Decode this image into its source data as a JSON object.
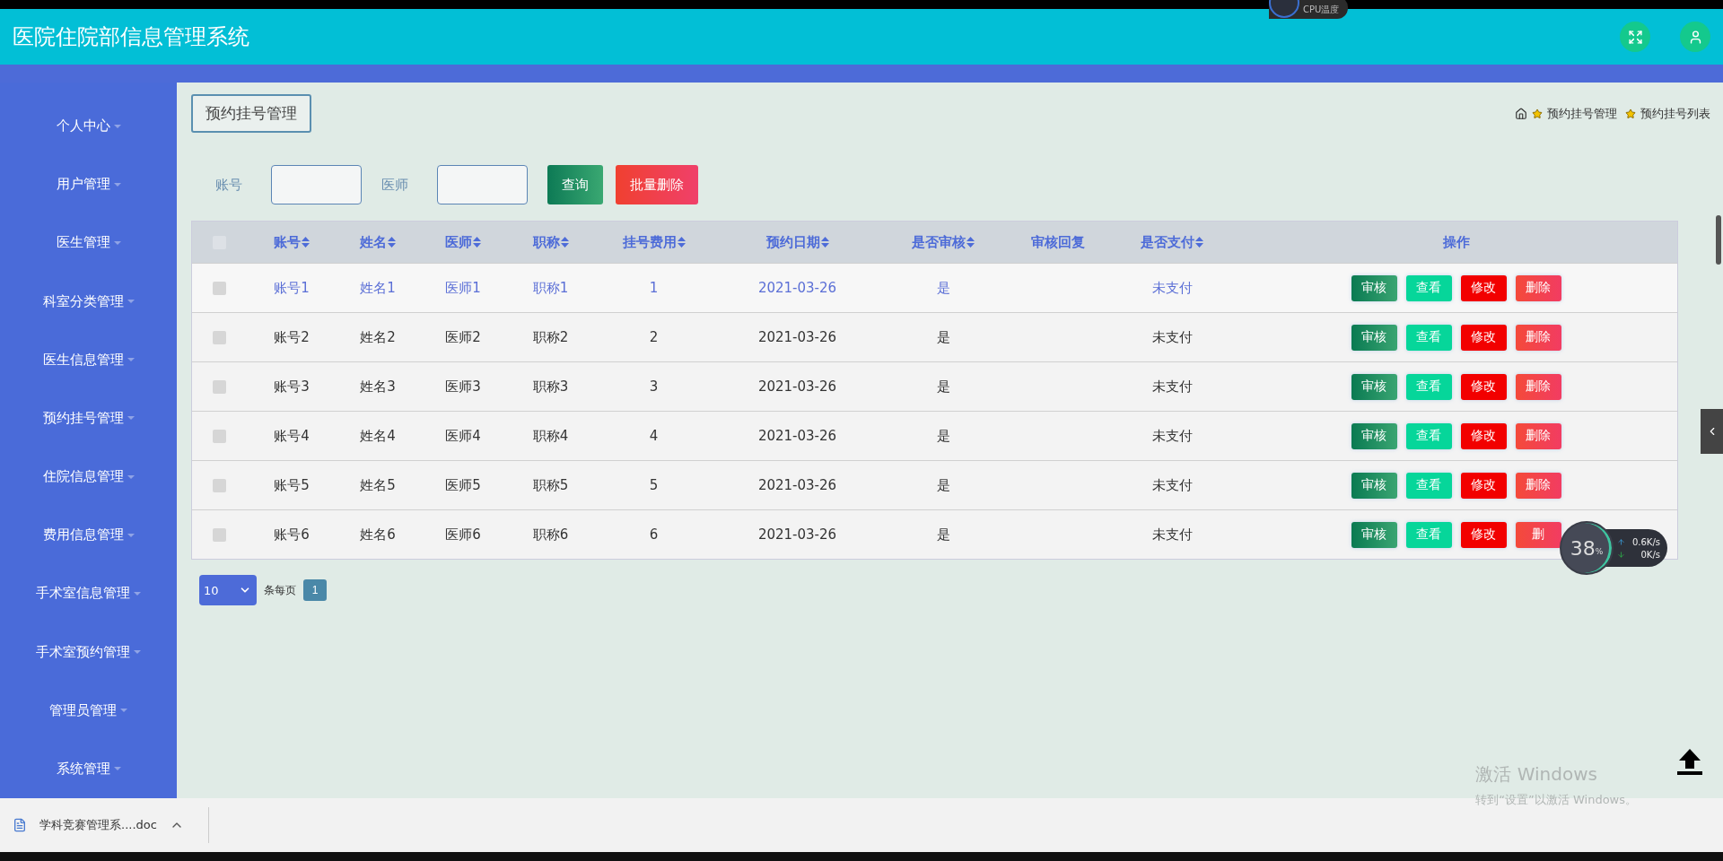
{
  "header": {
    "title": "医院住院部信息管理系统"
  },
  "sidebar": {
    "items": [
      {
        "label": "个人中心"
      },
      {
        "label": "用户管理"
      },
      {
        "label": "医生管理"
      },
      {
        "label": "科室分类管理"
      },
      {
        "label": "医生信息管理"
      },
      {
        "label": "预约挂号管理"
      },
      {
        "label": "住院信息管理"
      },
      {
        "label": "费用信息管理"
      },
      {
        "label": "手术室信息管理"
      },
      {
        "label": "手术室预约管理"
      },
      {
        "label": "管理员管理"
      },
      {
        "label": "系统管理"
      }
    ]
  },
  "breadcrumb": {
    "tag": "预约挂号管理",
    "trail": [
      "预约挂号管理",
      "预约挂号列表"
    ]
  },
  "search": {
    "fields": [
      {
        "label": "账号"
      },
      {
        "label": "医师"
      }
    ],
    "buttons": [
      {
        "label": "查询",
        "kind": "query"
      },
      {
        "label": "批量删除",
        "kind": "bulk-delete"
      }
    ]
  },
  "table": {
    "header_checked": false,
    "columns": [
      {
        "label": "账号",
        "sortable": true
      },
      {
        "label": "姓名",
        "sortable": true
      },
      {
        "label": "医师",
        "sortable": true
      },
      {
        "label": "职称",
        "sortable": true
      },
      {
        "label": "挂号费用",
        "sortable": true
      },
      {
        "label": "预约日期",
        "sortable": true
      },
      {
        "label": "是否审核",
        "sortable": true
      },
      {
        "label": "审核回复",
        "sortable": false
      },
      {
        "label": "是否支付",
        "sortable": true
      },
      {
        "label": "操作",
        "sortable": false
      }
    ],
    "rows": [
      {
        "selected": true,
        "checked": false,
        "cells": [
          "账号1",
          "姓名1",
          "医师1",
          "职称1",
          "1",
          "2021-03-26",
          "是",
          null,
          "未支付"
        ],
        "actions": [
          {
            "label": "审核",
            "kind": "review"
          },
          {
            "label": "查看",
            "kind": "view"
          },
          {
            "label": "修改",
            "kind": "edit"
          },
          {
            "label": "删除",
            "kind": "delete"
          }
        ]
      },
      {
        "selected": false,
        "checked": false,
        "cells": [
          "账号2",
          "姓名2",
          "医师2",
          "职称2",
          "2",
          "2021-03-26",
          "是",
          null,
          "未支付"
        ],
        "actions": [
          {
            "label": "审核",
            "kind": "review"
          },
          {
            "label": "查看",
            "kind": "view"
          },
          {
            "label": "修改",
            "kind": "edit"
          },
          {
            "label": "删除",
            "kind": "delete"
          }
        ]
      },
      {
        "selected": false,
        "checked": false,
        "cells": [
          "账号3",
          "姓名3",
          "医师3",
          "职称3",
          "3",
          "2021-03-26",
          "是",
          null,
          "未支付"
        ],
        "actions": [
          {
            "label": "审核",
            "kind": "review"
          },
          {
            "label": "查看",
            "kind": "view"
          },
          {
            "label": "修改",
            "kind": "edit"
          },
          {
            "label": "删除",
            "kind": "delete"
          }
        ]
      },
      {
        "selected": false,
        "checked": false,
        "cells": [
          "账号4",
          "姓名4",
          "医师4",
          "职称4",
          "4",
          "2021-03-26",
          "是",
          null,
          "未支付"
        ],
        "actions": [
          {
            "label": "审核",
            "kind": "review"
          },
          {
            "label": "查看",
            "kind": "view"
          },
          {
            "label": "修改",
            "kind": "edit"
          },
          {
            "label": "删除",
            "kind": "delete"
          }
        ]
      },
      {
        "selected": false,
        "checked": false,
        "cells": [
          "账号5",
          "姓名5",
          "医师5",
          "职称5",
          "5",
          "2021-03-26",
          "是",
          null,
          "未支付"
        ],
        "actions": [
          {
            "label": "审核",
            "kind": "review"
          },
          {
            "label": "查看",
            "kind": "view"
          },
          {
            "label": "修改",
            "kind": "edit"
          },
          {
            "label": "删除",
            "kind": "delete"
          }
        ]
      },
      {
        "selected": false,
        "checked": false,
        "cells": [
          "账号6",
          "姓名6",
          "医师6",
          "职称6",
          "6",
          "2021-03-26",
          "是",
          null,
          "未支付"
        ],
        "actions": [
          {
            "label": "审核",
            "kind": "review"
          },
          {
            "label": "查看",
            "kind": "view"
          },
          {
            "label": "修改",
            "kind": "edit"
          },
          {
            "label": "删",
            "kind": "delete"
          }
        ]
      }
    ]
  },
  "pagination": {
    "page_size": "10",
    "unit": "条每页",
    "pages": [
      {
        "label": "1",
        "selected": true
      }
    ]
  },
  "download_bar": {
    "file": "学科竞赛管理系....doc"
  },
  "overlays": {
    "cpu_label": "CPU温度",
    "net_monitor": {
      "percent": "38",
      "percent_sign": "%",
      "upload": "0.6K/s",
      "download": "0K/s"
    },
    "activation": {
      "title": "激活 Windows",
      "subtitle": "转到“设置”以激活 Windows。"
    }
  }
}
